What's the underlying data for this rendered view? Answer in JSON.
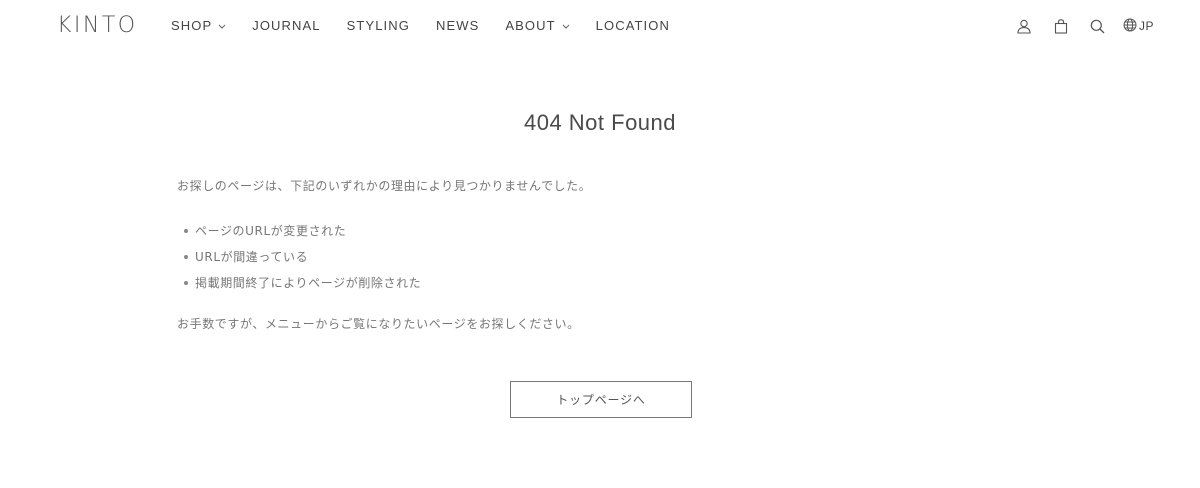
{
  "brand": {
    "logo_text": "KINTO"
  },
  "nav": {
    "items": [
      {
        "label": "SHOP",
        "has_dropdown": true
      },
      {
        "label": "JOURNAL",
        "has_dropdown": false
      },
      {
        "label": "STYLING",
        "has_dropdown": false
      },
      {
        "label": "NEWS",
        "has_dropdown": false
      },
      {
        "label": "ABOUT",
        "has_dropdown": true
      },
      {
        "label": "LOCATION",
        "has_dropdown": false
      }
    ]
  },
  "tools": {
    "icons": [
      "user-icon",
      "bag-icon",
      "search-icon",
      "globe-icon"
    ],
    "language": "JP"
  },
  "main": {
    "title": "404 Not Found",
    "intro": "お探しのページは、下記のいずれかの理由により見つかりませんでした。",
    "reasons": [
      "ページのURLが変更された",
      "URLが間違っている",
      "掲載期間終了によりページが削除された"
    ],
    "outro": "お手数ですが、メニューからご覧になりたいページをお探しください。",
    "button_label": "トップページへ"
  },
  "colors": {
    "text": "#4a4a4a",
    "muted": "#777777",
    "border": "#777777",
    "background": "#ffffff"
  }
}
